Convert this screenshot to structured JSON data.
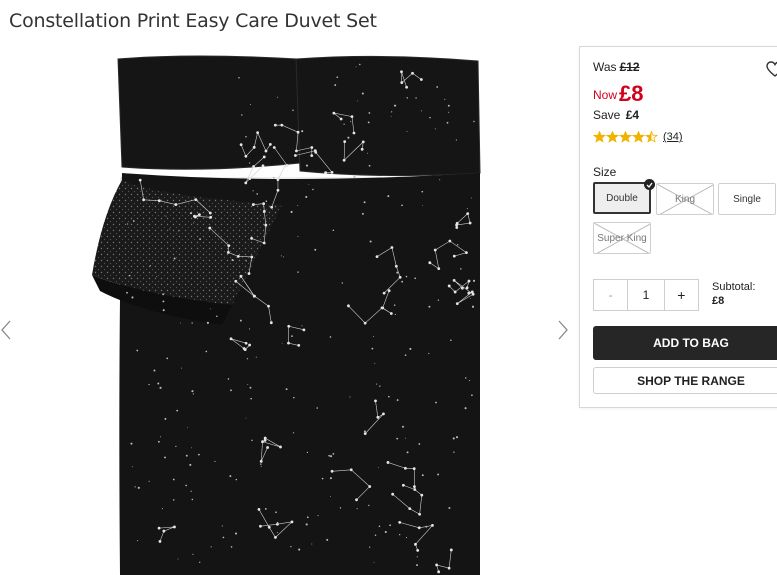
{
  "product": {
    "title": "Constellation Print Easy Care Duvet Set",
    "image_alt": "Black duvet cover with constellation print"
  },
  "pricing": {
    "was_label": "Was",
    "was_price": "£12",
    "now_label": "Now",
    "now_price": "£8",
    "save_label": "Save",
    "save_amount": "£4",
    "accent_color": "#d0021b"
  },
  "rating": {
    "stars_value": 4.5,
    "stars_max": 5,
    "review_count": "(34)",
    "star_color": "#f0b400"
  },
  "size": {
    "label": "Size",
    "options": [
      {
        "label": "Double",
        "selected": true,
        "available": true
      },
      {
        "label": "King",
        "selected": false,
        "available": false
      },
      {
        "label": "Single",
        "selected": false,
        "available": true
      },
      {
        "label": "Super King",
        "selected": false,
        "available": false
      }
    ]
  },
  "quantity": {
    "minus": "-",
    "value": "1",
    "plus": "+"
  },
  "subtotal": {
    "label": "Subtotal:",
    "value": "£8"
  },
  "actions": {
    "add_to_bag": "ADD TO BAG",
    "shop_range": "SHOP THE RANGE"
  },
  "icons": {
    "wishlist": "heart-icon",
    "prev": "chevron-left-icon",
    "next": "chevron-right-icon"
  }
}
